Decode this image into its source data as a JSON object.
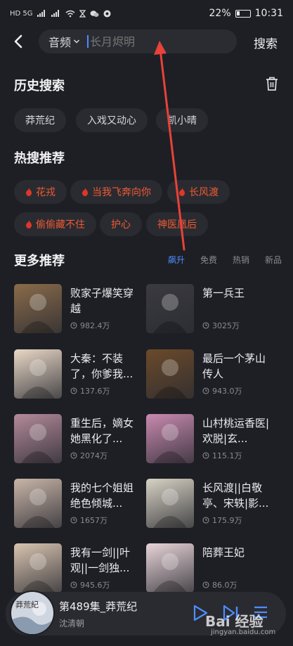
{
  "status_bar": {
    "signal_left": "HD 5G",
    "battery": "22%",
    "time": "10:31"
  },
  "search": {
    "scope_label": "音频",
    "placeholder": "长月烬明",
    "submit_label": "搜索"
  },
  "history": {
    "title": "历史搜索",
    "items": [
      "莽荒纪",
      "入戏又动心",
      "凯小晴"
    ]
  },
  "hot": {
    "title": "热搜推荐",
    "items": [
      "花戎",
      "当我飞奔向你",
      "长风渡",
      "偷偷藏不住",
      "护心",
      "神医凰后"
    ],
    "flagged": [
      true,
      true,
      true,
      true,
      false,
      false
    ]
  },
  "more": {
    "title": "更多推荐",
    "tabs": [
      "飙升",
      "免费",
      "热销",
      "新品"
    ],
    "active_tab": 0,
    "books": [
      {
        "title": "败家子爆笑穿越",
        "count": "982.4万",
        "cover": "#8a6b4a"
      },
      {
        "title": "第一兵王",
        "count": "3025万",
        "cover": "#3a3a40"
      },
      {
        "title": "大秦：不装了，你爹我...",
        "count": "137.6万",
        "cover": "#e9d8c6"
      },
      {
        "title": "最后一个茅山传人",
        "count": "943.0万",
        "cover": "#6b4a2a"
      },
      {
        "title": "重生后，嫡女她黑化了...",
        "count": "2074万",
        "cover": "#b48a9a"
      },
      {
        "title": "山村桃运香医|欢脱|玄...",
        "count": "115.1万",
        "cover": "#c98ab0"
      },
      {
        "title": "我的七个姐姐绝色倾城...",
        "count": "1657万",
        "cover": "#c9b5a8"
      },
      {
        "title": "长风渡||白敬亭、宋轶|影...",
        "count": "175.9万",
        "cover": "#d8d2c4"
      },
      {
        "title": "我有一剑||叶观||一剑独...",
        "count": "945.6万",
        "cover": "#d9c4b0"
      },
      {
        "title": "陪葬王妃",
        "count": "86.0万",
        "cover": "#e8d4d8"
      }
    ]
  },
  "player": {
    "title": "第489集_莽荒纪",
    "author": "沈清朝"
  },
  "watermark": {
    "brand": "Bai 经验",
    "url": "jingyan.baidu.com"
  },
  "colors": {
    "accent": "#4f8cff",
    "hot": "#ef5a34",
    "background": "#1e1f24",
    "chip": "#2a2b31",
    "annotation_arrow": "#e8423a"
  }
}
